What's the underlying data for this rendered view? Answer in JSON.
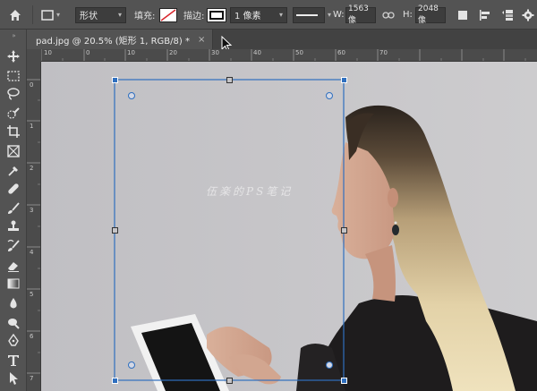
{
  "options_bar": {
    "home_icon": "home-icon",
    "shape_mode": "形状",
    "fill_label": "填充:",
    "stroke_label": "描边:",
    "stroke_width": "1 像素",
    "width_label": "W:",
    "width_value": "1563 像",
    "height_label": "H:",
    "height_value": "2048 像"
  },
  "document": {
    "tab_title": "pad.jpg @ 20.5% (矩形 1, RGB/8) *",
    "close": "×"
  },
  "ruler": {
    "h_labels": [
      "10",
      "0",
      "10",
      "20",
      "30",
      "40",
      "50",
      "60",
      "70"
    ],
    "v_labels": [
      "0",
      "1",
      "2",
      "3",
      "4",
      "5",
      "6",
      "7"
    ]
  },
  "canvas": {
    "watermark": "伍楽的PS笔记"
  },
  "colors": {
    "bg": "#535353",
    "canvas": "#c5c4c7",
    "selection": "#2f6fbf"
  }
}
